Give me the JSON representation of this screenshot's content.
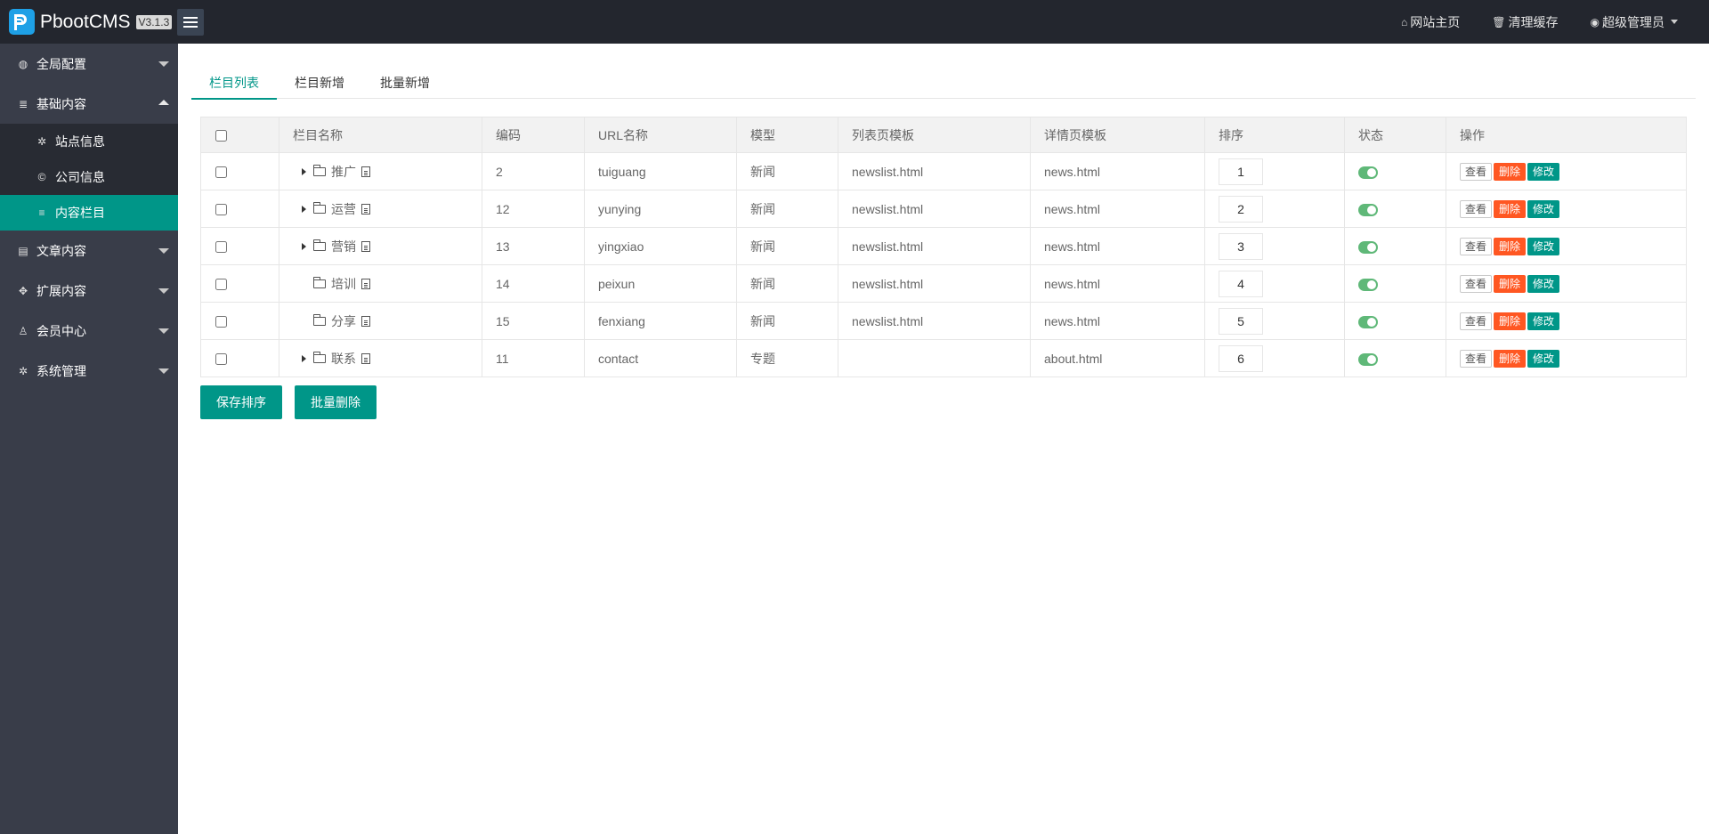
{
  "header": {
    "brand": "PbootCMS",
    "version": "V3.1.3",
    "links": [
      {
        "icon": "home-icon",
        "glyph": "⌂",
        "label": "网站主页"
      },
      {
        "icon": "trash-icon",
        "glyph": "🗑",
        "label": "清理缓存"
      },
      {
        "icon": "user-circle-icon",
        "glyph": "◉",
        "label": "超级管理员"
      }
    ]
  },
  "sidebar": {
    "items": [
      {
        "label": "全局配置",
        "icon": "globe-icon",
        "glyph": "◍",
        "open": false
      },
      {
        "label": "基础内容",
        "icon": "sliders-icon",
        "glyph": "≣",
        "open": true
      },
      {
        "label": "文章内容",
        "icon": "file-icon",
        "glyph": "▤",
        "open": false
      },
      {
        "label": "扩展内容",
        "icon": "expand-icon",
        "glyph": "✥",
        "open": false
      },
      {
        "label": "会员中心",
        "icon": "user-icon",
        "glyph": "♙",
        "open": false
      },
      {
        "label": "系统管理",
        "icon": "cog-icon",
        "glyph": "✲",
        "open": false
      }
    ],
    "sub_items": [
      {
        "label": "站点信息",
        "icon": "gear-icon",
        "glyph": "✲"
      },
      {
        "label": "公司信息",
        "icon": "copyright-icon",
        "glyph": "©"
      },
      {
        "label": "内容栏目",
        "icon": "list-icon",
        "glyph": "≡"
      }
    ]
  },
  "tabs": [
    "栏目列表",
    "栏目新增",
    "批量新增"
  ],
  "table": {
    "headers": [
      "栏目名称",
      "编码",
      "URL名称",
      "模型",
      "列表页模板",
      "详情页模板",
      "排序",
      "状态",
      "操作"
    ],
    "rows": [
      {
        "name": "推广",
        "has_children": true,
        "code": "2",
        "url": "tuiguang",
        "model": "新闻",
        "list_tpl": "newslist.html",
        "detail_tpl": "news.html",
        "sort": "1"
      },
      {
        "name": "运营",
        "has_children": true,
        "code": "12",
        "url": "yunying",
        "model": "新闻",
        "list_tpl": "newslist.html",
        "detail_tpl": "news.html",
        "sort": "2"
      },
      {
        "name": "营销",
        "has_children": true,
        "code": "13",
        "url": "yingxiao",
        "model": "新闻",
        "list_tpl": "newslist.html",
        "detail_tpl": "news.html",
        "sort": "3"
      },
      {
        "name": "培训",
        "has_children": false,
        "code": "14",
        "url": "peixun",
        "model": "新闻",
        "list_tpl": "newslist.html",
        "detail_tpl": "news.html",
        "sort": "4"
      },
      {
        "name": "分享",
        "has_children": false,
        "code": "15",
        "url": "fenxiang",
        "model": "新闻",
        "list_tpl": "newslist.html",
        "detail_tpl": "news.html",
        "sort": "5"
      },
      {
        "name": "联系",
        "has_children": true,
        "code": "11",
        "url": "contact",
        "model": "专题",
        "list_tpl": "",
        "detail_tpl": "about.html",
        "sort": "6"
      }
    ],
    "row_buttons": {
      "view": "查看",
      "delete": "删除",
      "edit": "修改"
    }
  },
  "actions": {
    "save_sort": "保存排序",
    "batch_delete": "批量删除"
  },
  "colors": {
    "accent": "#009688",
    "danger": "#ff5722",
    "switch_on": "#5fb878",
    "sidebar_bg": "#393d49",
    "header_bg": "#23262e"
  }
}
